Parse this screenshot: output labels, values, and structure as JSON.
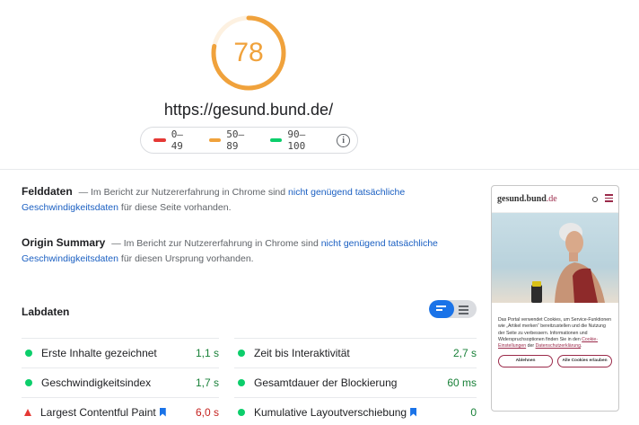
{
  "score": {
    "value": "78",
    "fraction": 0.78,
    "color": "#f0a23c",
    "track_color": "#fdf1e1"
  },
  "url": "https://gesund.bund.de/",
  "legend": {
    "items": [
      {
        "label": "0–49",
        "color": "#e53935"
      },
      {
        "label": "50–89",
        "color": "#f0a23c"
      },
      {
        "label": "90–100",
        "color": "#0cce6b"
      }
    ],
    "info_icon": "info-icon",
    "info_glyph": "i"
  },
  "felddaten": {
    "title": "Felddaten",
    "text_before": "— Im Bericht zur Nutzererfahrung in Chrome sind",
    "link": "nicht genügend tatsächliche Geschwindigkeitsdaten",
    "text_after": "für diese Seite vorhanden."
  },
  "origin_summary": {
    "title": "Origin Summary",
    "text_before": "— Im Bericht zur Nutzererfahrung in Chrome sind",
    "link": "nicht genügend tatsächliche Geschwindigkeitsdaten",
    "text_after": "für diesen Ursprung vorhanden."
  },
  "labdaten": {
    "title": "Labdaten"
  },
  "metrics": [
    {
      "name": "Erste Inhalte gezeichnet",
      "value": "1,1 s",
      "status": "good"
    },
    {
      "name": "Zeit bis Interaktivität",
      "value": "2,7 s",
      "status": "good"
    },
    {
      "name": "Geschwindigkeitsindex",
      "value": "1,7 s",
      "status": "good"
    },
    {
      "name": "Gesamtdauer der Blockierung",
      "value": "60 ms",
      "status": "good"
    },
    {
      "name": "Largest Contentful Paint",
      "value": "6,0 s",
      "status": "bad",
      "flag": true
    },
    {
      "name": "Kumulative Layoutverschiebung",
      "value": "0",
      "status": "good",
      "flag": true
    }
  ],
  "screenshot": {
    "logo_main": "gesund.bund",
    "logo_suffix": ".de",
    "cookie_text_1": "Das Portal verwendet Cookies, um Service-Funktionen wie „Artikel merken“ bereitzustellen und die Nutzung der Seite zu verbessern. Informationen und Widerspruchsoptionen finden Sie in den",
    "cookie_link_1": "Cookie-Einstellungen",
    "cookie_mid": "der",
    "cookie_link_2": "Datenschutzerklärung",
    "cookie_end": ".",
    "btn_reject": "Ablehnen",
    "btn_accept": "Alle Cookies erlauben"
  }
}
